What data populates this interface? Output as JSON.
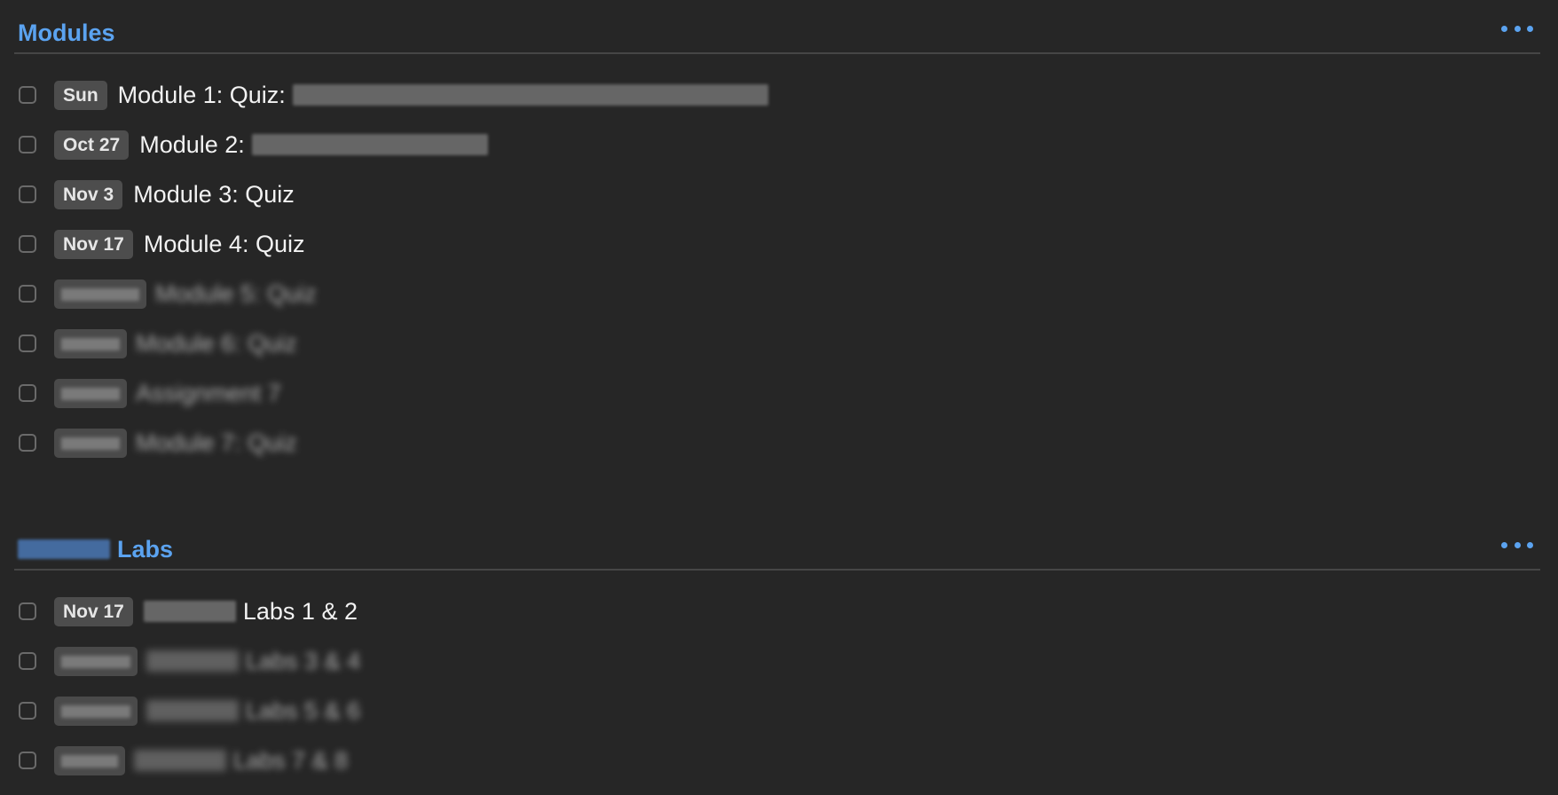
{
  "sections": [
    {
      "title": "Modules",
      "tasks": [
        {
          "date": "Sun",
          "title": "Module 1: Quiz:"
        },
        {
          "date": "Oct 27",
          "title": "Module 2:"
        },
        {
          "date": "Nov 3",
          "title": "Module 3: Quiz"
        },
        {
          "date": "Nov 17",
          "title": "Module 4: Quiz"
        },
        {
          "date": "",
          "title": "Module 5: Quiz"
        },
        {
          "date": "",
          "title": "Module 6: Quiz"
        },
        {
          "date": "",
          "title": "Assignment 7"
        },
        {
          "date": "",
          "title": "Module 7: Quiz"
        }
      ]
    },
    {
      "title": "Labs",
      "tasks": [
        {
          "date": "Nov 17",
          "title": "Labs 1 & 2"
        },
        {
          "date": "",
          "title": "Labs 3 & 4"
        },
        {
          "date": "",
          "title": "Labs 5 & 6"
        },
        {
          "date": "",
          "title": "Labs 7 & 8"
        }
      ]
    }
  ],
  "colors": {
    "background": "#262626",
    "accent": "#5ba3f0",
    "badge": "#4d4d4d",
    "text": "#f2f2f2"
  },
  "icons": {
    "more": "more-horizontal-icon"
  }
}
